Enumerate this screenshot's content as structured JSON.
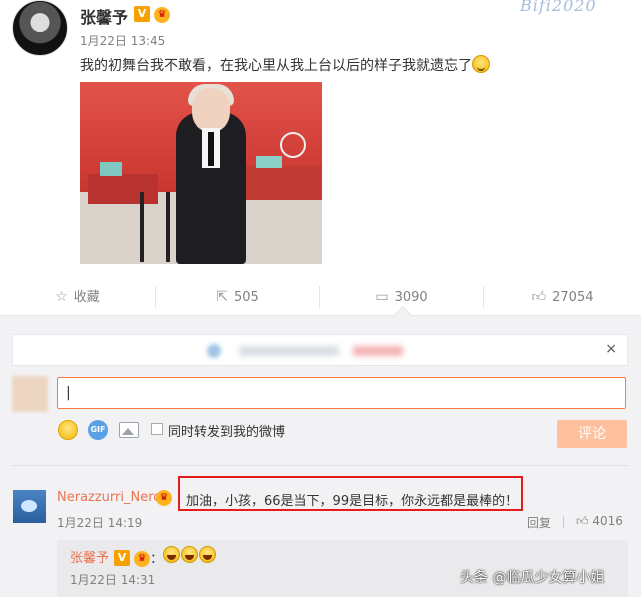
{
  "post": {
    "username": "张馨予",
    "time": "1月22日 13:45",
    "text": "我的初舞台我不敢看，在我心里从我上台以后的样子我就遗忘了",
    "watermark_top": "Bifi2020"
  },
  "actions": {
    "favorite_label": "收藏",
    "share_count": "505",
    "comment_count": "3090",
    "like_count": "27054"
  },
  "comment_box": {
    "input_value": "|",
    "repost_label": "同时转发到我的微博",
    "submit_label": "评论",
    "close_icon": "×"
  },
  "comment": {
    "username": "Nerazzurri_Nero",
    "text": "加油，小孩，66是当下，99是目标，你永远都是最棒的！",
    "time": "1月22日 14:19",
    "reply_label": "回复",
    "like_count": "4016"
  },
  "sub_reply": {
    "username": "张馨予",
    "colon": "：",
    "time": "1月22日 14:31"
  },
  "watermark_bottom": "头条 @临瓜少女算小姐",
  "colors": {
    "accent_orange": "#fa7d3c",
    "username_color": "#eb7350",
    "highlight_red": "#e41c1c"
  }
}
